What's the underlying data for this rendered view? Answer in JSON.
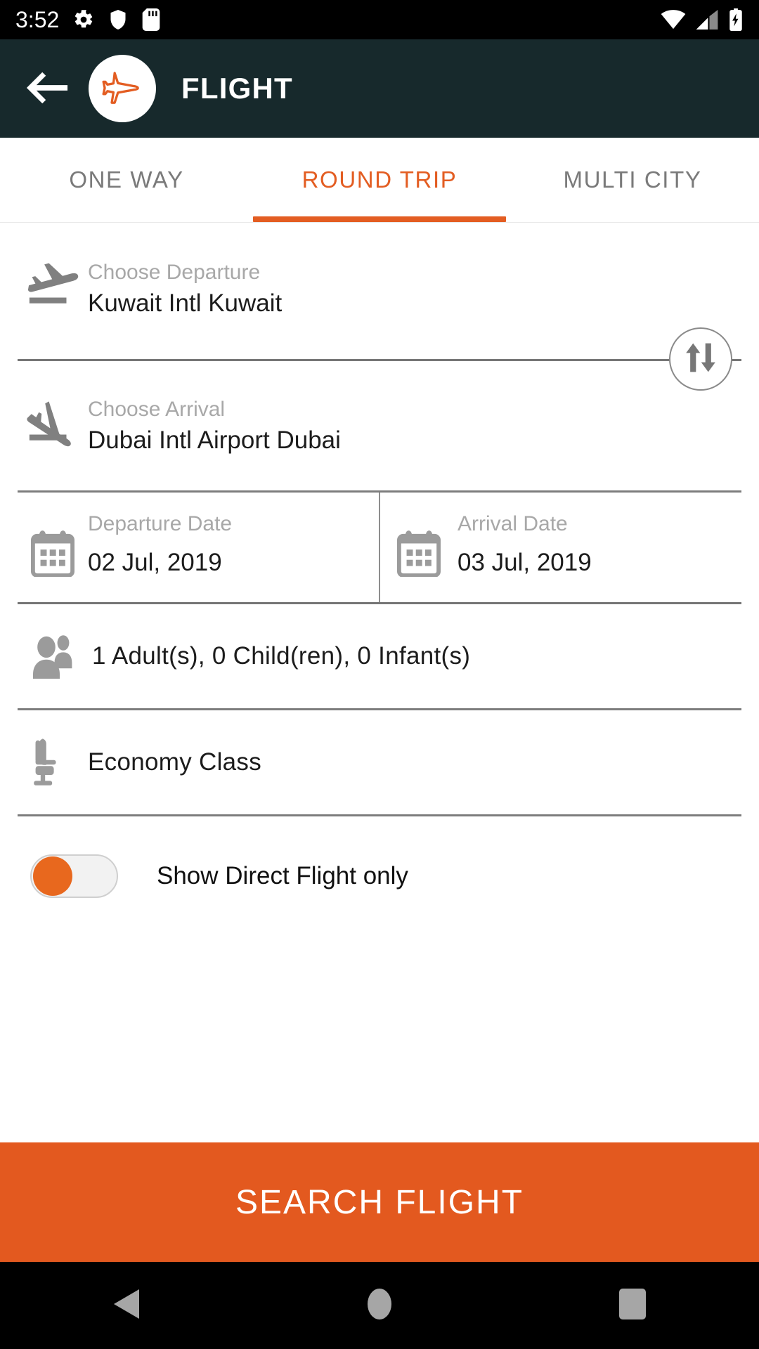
{
  "status_bar": {
    "clock": "3:52",
    "left_icons": [
      "gear-icon",
      "shield-icon",
      "sd-card-icon"
    ],
    "right_icons": [
      "wifi-icon",
      "cellular-signal-icon",
      "battery-charging-icon"
    ]
  },
  "app_bar": {
    "back_icon": "back-arrow-icon",
    "logo_icon": "airplane-logo-icon",
    "title": "FLIGHT",
    "background_color": "#17292c"
  },
  "tabs": {
    "items": [
      {
        "label": "ONE WAY",
        "active": false
      },
      {
        "label": "ROUND TRIP",
        "active": true
      },
      {
        "label": "MULTI CITY",
        "active": false
      }
    ],
    "active_color": "#e35d22",
    "inactive_color": "#7a7a7a"
  },
  "form": {
    "departure": {
      "icon": "flight-takeoff-icon",
      "label": "Choose Departure",
      "value": "Kuwait Intl Kuwait"
    },
    "arrival": {
      "icon": "flight-land-icon",
      "label": "Choose Arrival",
      "value": "Dubai Intl Airport Dubai"
    },
    "swap": {
      "icon": "swap-vertical-icon"
    },
    "departure_date": {
      "icon": "calendar-icon",
      "label": "Departure Date",
      "value": "02 Jul, 2019"
    },
    "arrival_date": {
      "icon": "calendar-icon",
      "label": "Arrival Date",
      "value": "03 Jul, 2019"
    },
    "passengers": {
      "icon": "people-icon",
      "value": "1  Adult(s),  0  Child(ren),  0  Infant(s)"
    },
    "cabin_class": {
      "icon": "airline-seat-icon",
      "value": "Economy Class"
    },
    "direct_flight_toggle": {
      "label": "Show Direct Flight only",
      "state": "off",
      "knob_color": "#e8681e",
      "track_color": "#f2f2f2"
    }
  },
  "search_button": {
    "label": "SEARCH FLIGHT",
    "background_color": "#e3591f",
    "text_color": "#ffffff"
  },
  "nav_bar": {
    "items": [
      {
        "icon": "nav-back-icon"
      },
      {
        "icon": "nav-home-icon"
      },
      {
        "icon": "nav-recents-icon"
      }
    ]
  }
}
